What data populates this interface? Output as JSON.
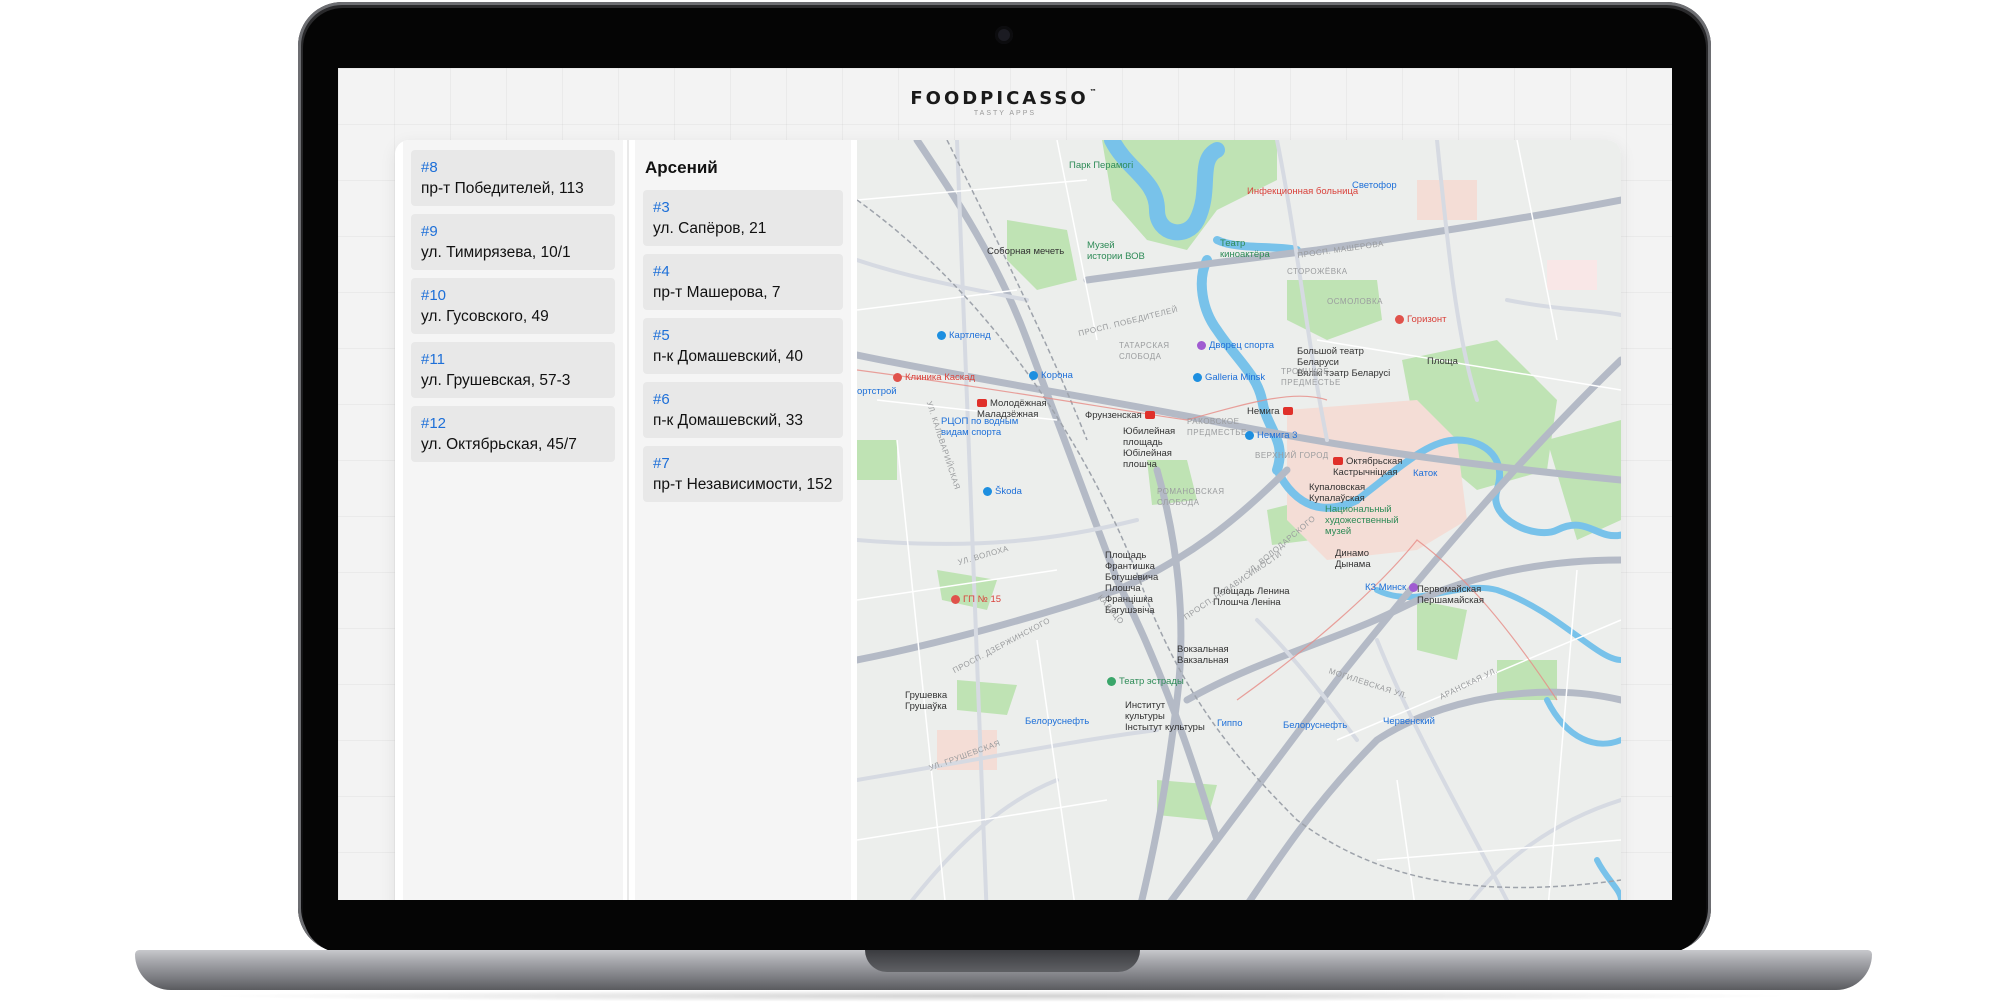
{
  "brand": {
    "name": "FOODPICASSO",
    "tm": "™",
    "tagline": "TASTY APPS"
  },
  "column1": {
    "header": "",
    "items": [
      {
        "num": "#8",
        "address": "пр-т Победителей, 113"
      },
      {
        "num": "#9",
        "address": "ул. Тимирязева, 10/1"
      },
      {
        "num": "#10",
        "address": "ул. Гусовского, 49"
      },
      {
        "num": "#11",
        "address": "ул. Грушевская, 57-3"
      },
      {
        "num": "#12",
        "address": "ул. Октябрьская, 45/7"
      }
    ]
  },
  "column2": {
    "header": "Арсений",
    "items": [
      {
        "num": "#3",
        "address": "ул. Сапёров, 21"
      },
      {
        "num": "#4",
        "address": "пр-т Машерова, 7"
      },
      {
        "num": "#5",
        "address": "п-к Домашевский, 40"
      },
      {
        "num": "#6",
        "address": "п-к Домашевский, 33"
      },
      {
        "num": "#7",
        "address": "пр-т Независимости, 152"
      }
    ]
  },
  "map": {
    "labels": {
      "park": "Парк Перамогі",
      "infect": "Инфекционная больница",
      "svetofor": "Светофор",
      "mosque": "Соборная мечеть",
      "museum_line1": "Музей",
      "museum_line2": "истории ВОВ",
      "theatre_line1": "Театр",
      "theatre_line2": "киноактёра",
      "storozh": "СТОРОЖЁВКА",
      "osmolovka": "ОСМОЛОВКА",
      "gorizont": "Горизонт",
      "kartlend": "Картленд",
      "tatar_line1": "ТАТАРСКАЯ",
      "tatar_line2": "СЛОБОДА",
      "dvorets": "Дворец спорта",
      "bolshoi_line1": "Большой театр",
      "bolshoi_line2": "Беларуси",
      "bolshoi_line3": "Вялікі тэатр Беларусі",
      "kaskad": "Клиника Каскад",
      "korona": "Корона",
      "galleria": "Galleria Minsk",
      "troits_line1": "ТРОИЦКОЕ",
      "troits_line2": "ПРЕДМЕСТЬЕ",
      "ploshcha": "Площа",
      "molodezh": "Молодёжная",
      "molodezh_sub": "Маладзёжная",
      "frunz": "Фрунзенская",
      "nemiga": "Немига",
      "rcop_line1": "РЦОП по водным",
      "rcop_line2": "видам спорта",
      "yubil_line1": "Юбилейная",
      "yubil_line2": "площадь",
      "yubil_sub1": "Юбілейная",
      "yubil_sub2": "плошча",
      "rakov_line1": "РАКОВСКОЕ",
      "rakov_line2": "ПРЕДМЕСТЬЕ",
      "nemiga3": "Немига 3",
      "verkh": "ВЕРХНИЙ ГОРОД",
      "oktyabr": "Октябрьская",
      "oktyabr_sub": "Кастрычніцкая",
      "katok": "Каток",
      "skoda": "Škoda",
      "roman_line1": "РОМАНОВСКАЯ",
      "roman_line2": "СЛОБОДА",
      "kupal": "Купаловская",
      "kupal_sub": "Купалаўская",
      "nhm_line1": "Национальный",
      "nhm_line2": "художественный",
      "nhm_line3": "музей",
      "bogush_line1": "Площадь",
      "bogush_line2": "Франтишка",
      "bogush_line3": "Богушевича",
      "bogush_sub1": "Плошча",
      "bogush_sub2": "Францішка",
      "bogush_sub3": "Багушэвіча",
      "dinamo": "Динамо",
      "dinamo_sub": "Дынама",
      "gp15": "ГП № 15",
      "lenin": "Площадь Ленина",
      "lenin_sub": "Плошча Леніна",
      "kz": "КЗ Минск",
      "pervom": "Первомайская",
      "pervom_sub": "Першамайская",
      "vokzal": "Вокзальная",
      "vokzal_sub": "Вакзальная",
      "teatr_estr": "Театр эстрады",
      "grush": "Грушевка",
      "grush_sub": "Грушаўка",
      "inst_line1": "Институт",
      "inst_line2": "культуры",
      "inst_sub": "Інстытут культуры",
      "belneft": "Белоруснефть",
      "gippo": "Гиппо",
      "belneft2": "Белоруснефть",
      "cherv": "Червенский",
      "sportstreet": "ортстрой",
      "pr_mash": "ПРОСП. МАШЕРОВА",
      "pr_pobed": "ПРОСП. ПОБЕДИТЕЛЕЙ",
      "pr_dzerzh": "ПРОСП. ДЗЕРЖИНСКОГО",
      "pr_nez": "ПРОСП. НЕЗАВИСИМОСТИ",
      "ul_kalv": "УЛ. КАЛЬВАРИЙСКАЯ",
      "ul_volod": "УЛ. ВОЛОДАРСКОГО",
      "ul_aran": "АРАНСКАЯ УЛ.",
      "ul_mogil": "МОГИЛЕВСКАЯ УЛ.",
      "ul_volokh": "УЛ. ВОЛОХА",
      "ul_grushev": "УЛ. ГРУШЕВСКАЯ",
      "kalco": "КАЛЬЦО"
    }
  }
}
